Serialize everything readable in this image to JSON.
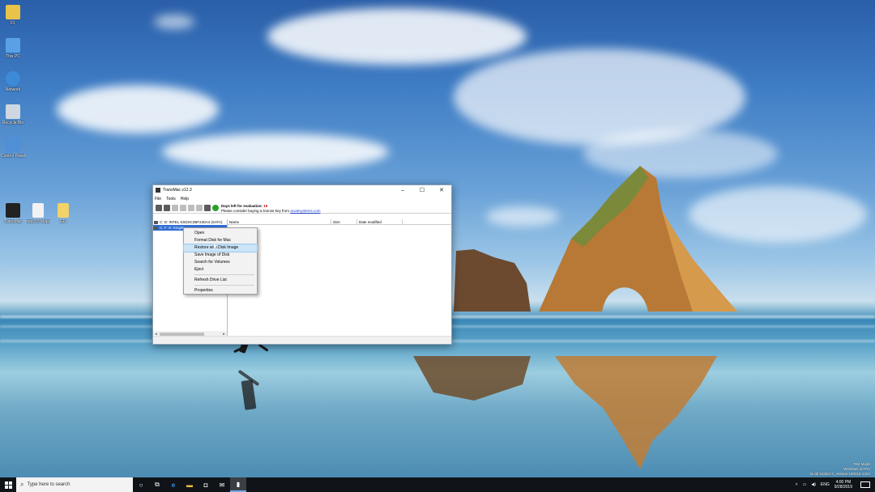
{
  "window": {
    "title": "TransMac v12.3",
    "menu": [
      "File",
      "Tools",
      "Help"
    ],
    "eval_title": "Days left for evaluation: 15",
    "eval_title_prefix": "Days left for evaluation: ",
    "eval_days": "15",
    "eval_line2_prefix": "Please consider buying a license key from ",
    "eval_link": "acutesystems.com",
    "drives": [
      "C: D:  INTEL SSDSC2BF240A4 (SATA)",
      "C: F: G: Kingst..."
    ],
    "columns": [
      "Name",
      "Size",
      "Date modified"
    ],
    "buttons": {
      "minimize": "–",
      "maximize": "☐",
      "close": "✕"
    }
  },
  "context_menu": {
    "items": [
      "Open",
      "Format Disk for Mac",
      "Restore with Disk Image",
      "Save Image of Disk",
      "Search for Volumes",
      "Eject",
      "Refresh Drive List",
      "Properties"
    ],
    "highlighted": "Restore with Disk Image"
  },
  "desktop_icons": [
    {
      "label": "F1",
      "color": "#e8c34a"
    },
    {
      "label": "This PC",
      "color": "#5aa0e6"
    },
    {
      "label": "Network",
      "color": "#3c8ad8"
    },
    {
      "label": "Recycle Bin",
      "color": "#cfd8e0"
    },
    {
      "label": "Control Panel",
      "color": "#4f8fd6"
    },
    {
      "label": "TransMac",
      "color": "#222222"
    },
    {
      "label": "macOS Mojave 10...",
      "color": "#f2f2f2"
    },
    {
      "label": "EFI",
      "color": "#f1d36a"
    }
  ],
  "watermark": {
    "line1": "Test Mode",
    "line2": "Windows 10 Pro",
    "line3": "Build 18362.rs_release.190318-1202"
  },
  "taskbar": {
    "search_placeholder": "Type here to search",
    "time": "4:00 PM",
    "date": "9/28/2019",
    "tray_text": "ENG"
  }
}
